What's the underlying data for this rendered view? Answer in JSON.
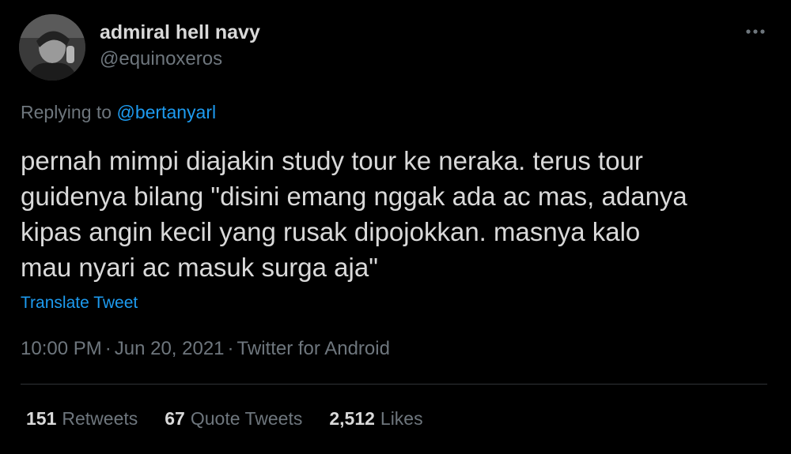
{
  "author": {
    "display_name": "admiral hell navy",
    "handle": "@equinoxeros",
    "avatar_icon": "profile-photo"
  },
  "more_icon": "ellipsis-icon",
  "reply": {
    "prefix": "Replying to",
    "mention": "@bertanyarl"
  },
  "tweet": {
    "lines": [
      "pernah mimpi diajakin study tour ke neraka. terus tour",
      "guidenya bilang \"disini emang nggak ada ac mas, adanya",
      "kipas angin kecil yang rusak dipojokkan. masnya kalo",
      "mau nyari ac masuk surga aja\""
    ],
    "translate_label": "Translate Tweet"
  },
  "meta": {
    "time": "10:00 PM",
    "separator": "·",
    "date": "Jun 20, 2021",
    "source": "Twitter for Android"
  },
  "stats": {
    "retweets": {
      "count": "151",
      "label": "Retweets"
    },
    "quotes": {
      "count": "67",
      "label": "Quote Tweets"
    },
    "likes": {
      "count": "2,512",
      "label": "Likes"
    }
  },
  "colors": {
    "background": "#000000",
    "text": "#d9d9d9",
    "secondary": "#6e767d",
    "accent": "#1d9bf0",
    "divider": "#2f3336"
  }
}
